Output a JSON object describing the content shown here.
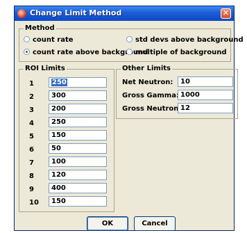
{
  "window": {
    "title": "Change Limit Method",
    "close_glyph": "✕"
  },
  "method": {
    "legend": "Method",
    "options": [
      {
        "label": "count rate",
        "checked": false
      },
      {
        "label": "std devs above background",
        "checked": false
      },
      {
        "label": "count rate above background",
        "checked": true
      },
      {
        "label": "multiple of background",
        "checked": false
      }
    ]
  },
  "roi": {
    "legend": "ROI Limits",
    "rows": [
      {
        "num": "1",
        "value": "250"
      },
      {
        "num": "2",
        "value": "300"
      },
      {
        "num": "3",
        "value": "200"
      },
      {
        "num": "4",
        "value": "250"
      },
      {
        "num": "5",
        "value": "150"
      },
      {
        "num": "6",
        "value": "50"
      },
      {
        "num": "7",
        "value": "100"
      },
      {
        "num": "8",
        "value": "120"
      },
      {
        "num": "9",
        "value": "400"
      },
      {
        "num": "10",
        "value": "150"
      }
    ]
  },
  "other": {
    "legend": "Other Limits",
    "net_neutron": {
      "label": "Net Neutron:",
      "value": "10"
    },
    "gross_gamma": {
      "label": "Gross Gamma:",
      "value": "1000"
    },
    "gross_neutron": {
      "label": "Gross Neutron:",
      "value": "12"
    }
  },
  "buttons": {
    "ok": "OK",
    "cancel": "Cancel"
  },
  "icons": {
    "app": "app-icon",
    "close": "close-icon"
  }
}
